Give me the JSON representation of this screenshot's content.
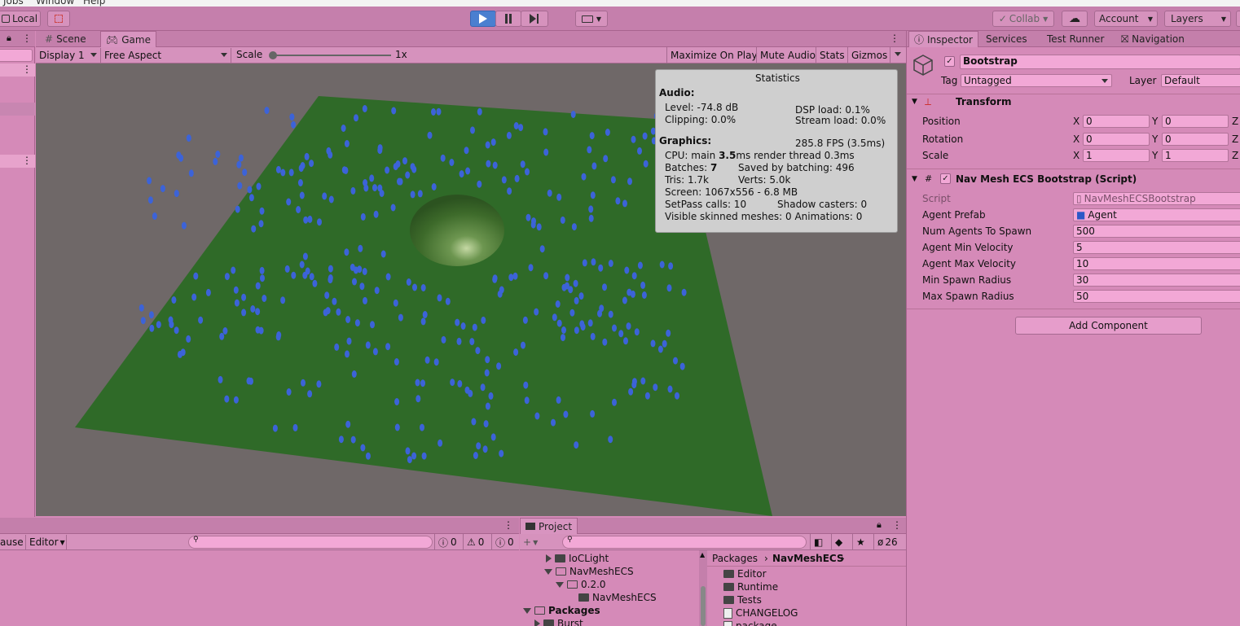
{
  "menubar": {
    "items": [
      "Jobs",
      "Window",
      "Help"
    ]
  },
  "toolbar": {
    "local_label": "Local",
    "collab_label": "Collab",
    "account_label": "Account",
    "layers_label": "Layers"
  },
  "left_panel": {
    "tabs": [
      "Scene",
      "Game"
    ]
  },
  "game_bar": {
    "display": "Display 1",
    "aspect": "Free Aspect",
    "scale_label": "Scale",
    "scale_value": "1x",
    "maximize": "Maximize On Play",
    "mute": "Mute Audio",
    "stats": "Stats",
    "gizmos": "Gizmos"
  },
  "stats": {
    "title": "Statistics",
    "audio_header": "Audio:",
    "level": "Level: -74.8 dB",
    "clipping": "Clipping: 0.0%",
    "dsp": "DSP load: 0.1%",
    "stream": "Stream load: 0.0%",
    "graphics_header": "Graphics:",
    "fps": "285.8 FPS (3.5ms)",
    "cpu_prefix": "CPU: main ",
    "cpu_main": "3.5",
    "cpu_suffix": "ms  render thread 0.3ms",
    "batches_prefix": "Batches: ",
    "batches": "7",
    "saved_batching": "Saved by batching: 496",
    "tris": "Tris: 1.7k",
    "verts": "Verts: 5.0k",
    "screen": "Screen: 1067x556 - 6.8 MB",
    "setpass": "SetPass calls: 10",
    "shadow": "Shadow casters: 0",
    "skinned": "Visible skinned meshes: 0  Animations: 0"
  },
  "console": {
    "pause_label": "ause",
    "editor_label": "Editor",
    "errors": "0",
    "warnings": "0",
    "infos": "0"
  },
  "project": {
    "tab": "Project",
    "hidden_count": "26",
    "breadcrumb_root": "Packages",
    "breadcrumb_current": "NavMeshECS",
    "tree": [
      {
        "label": "IoCLight",
        "indent": 0,
        "expanded": false
      },
      {
        "label": "NavMeshECS",
        "indent": 0,
        "expanded": true
      },
      {
        "label": "0.2.0",
        "indent": 1,
        "expanded": true
      },
      {
        "label": "NavMeshECS",
        "indent": 2,
        "expanded": null
      },
      {
        "label": "Packages",
        "indent": -1,
        "expanded": true
      },
      {
        "label": "Burst",
        "indent": 0,
        "expanded": false
      }
    ],
    "files": [
      "Editor",
      "Runtime",
      "Tests",
      "CHANGELOG",
      "package"
    ]
  },
  "inspector": {
    "tabs": [
      "Inspector",
      "Services",
      "Test Runner",
      "Navigation"
    ],
    "object_name": "Bootstrap",
    "tag_label": "Tag",
    "tag_value": "Untagged",
    "layer_label": "Layer",
    "layer_value": "Default",
    "transform": {
      "title": "Transform",
      "rows": [
        {
          "label": "Position",
          "x": "0",
          "y": "0"
        },
        {
          "label": "Rotation",
          "x": "0",
          "y": "0"
        },
        {
          "label": "Scale",
          "x": "1",
          "y": "1"
        }
      ]
    },
    "component": {
      "title": "Nav Mesh ECS Bootstrap (Script)",
      "script_label": "Script",
      "script_value": "NavMeshECSBootstrap",
      "fields": [
        {
          "label": "Agent Prefab",
          "value": "Agent"
        },
        {
          "label": "Num Agents To Spawn",
          "value": "500"
        },
        {
          "label": "Agent Min Velocity",
          "value": "5"
        },
        {
          "label": "Agent Max Velocity",
          "value": "10"
        },
        {
          "label": "Min Spawn Radius",
          "value": "30"
        },
        {
          "label": "Max Spawn Radius",
          "value": "50"
        }
      ]
    },
    "add_component": "Add Component"
  },
  "colors": {
    "ground": "#2f6a28",
    "agent": "#3c63d8",
    "sky": "#6f6868",
    "panel": "#d58ab8"
  }
}
